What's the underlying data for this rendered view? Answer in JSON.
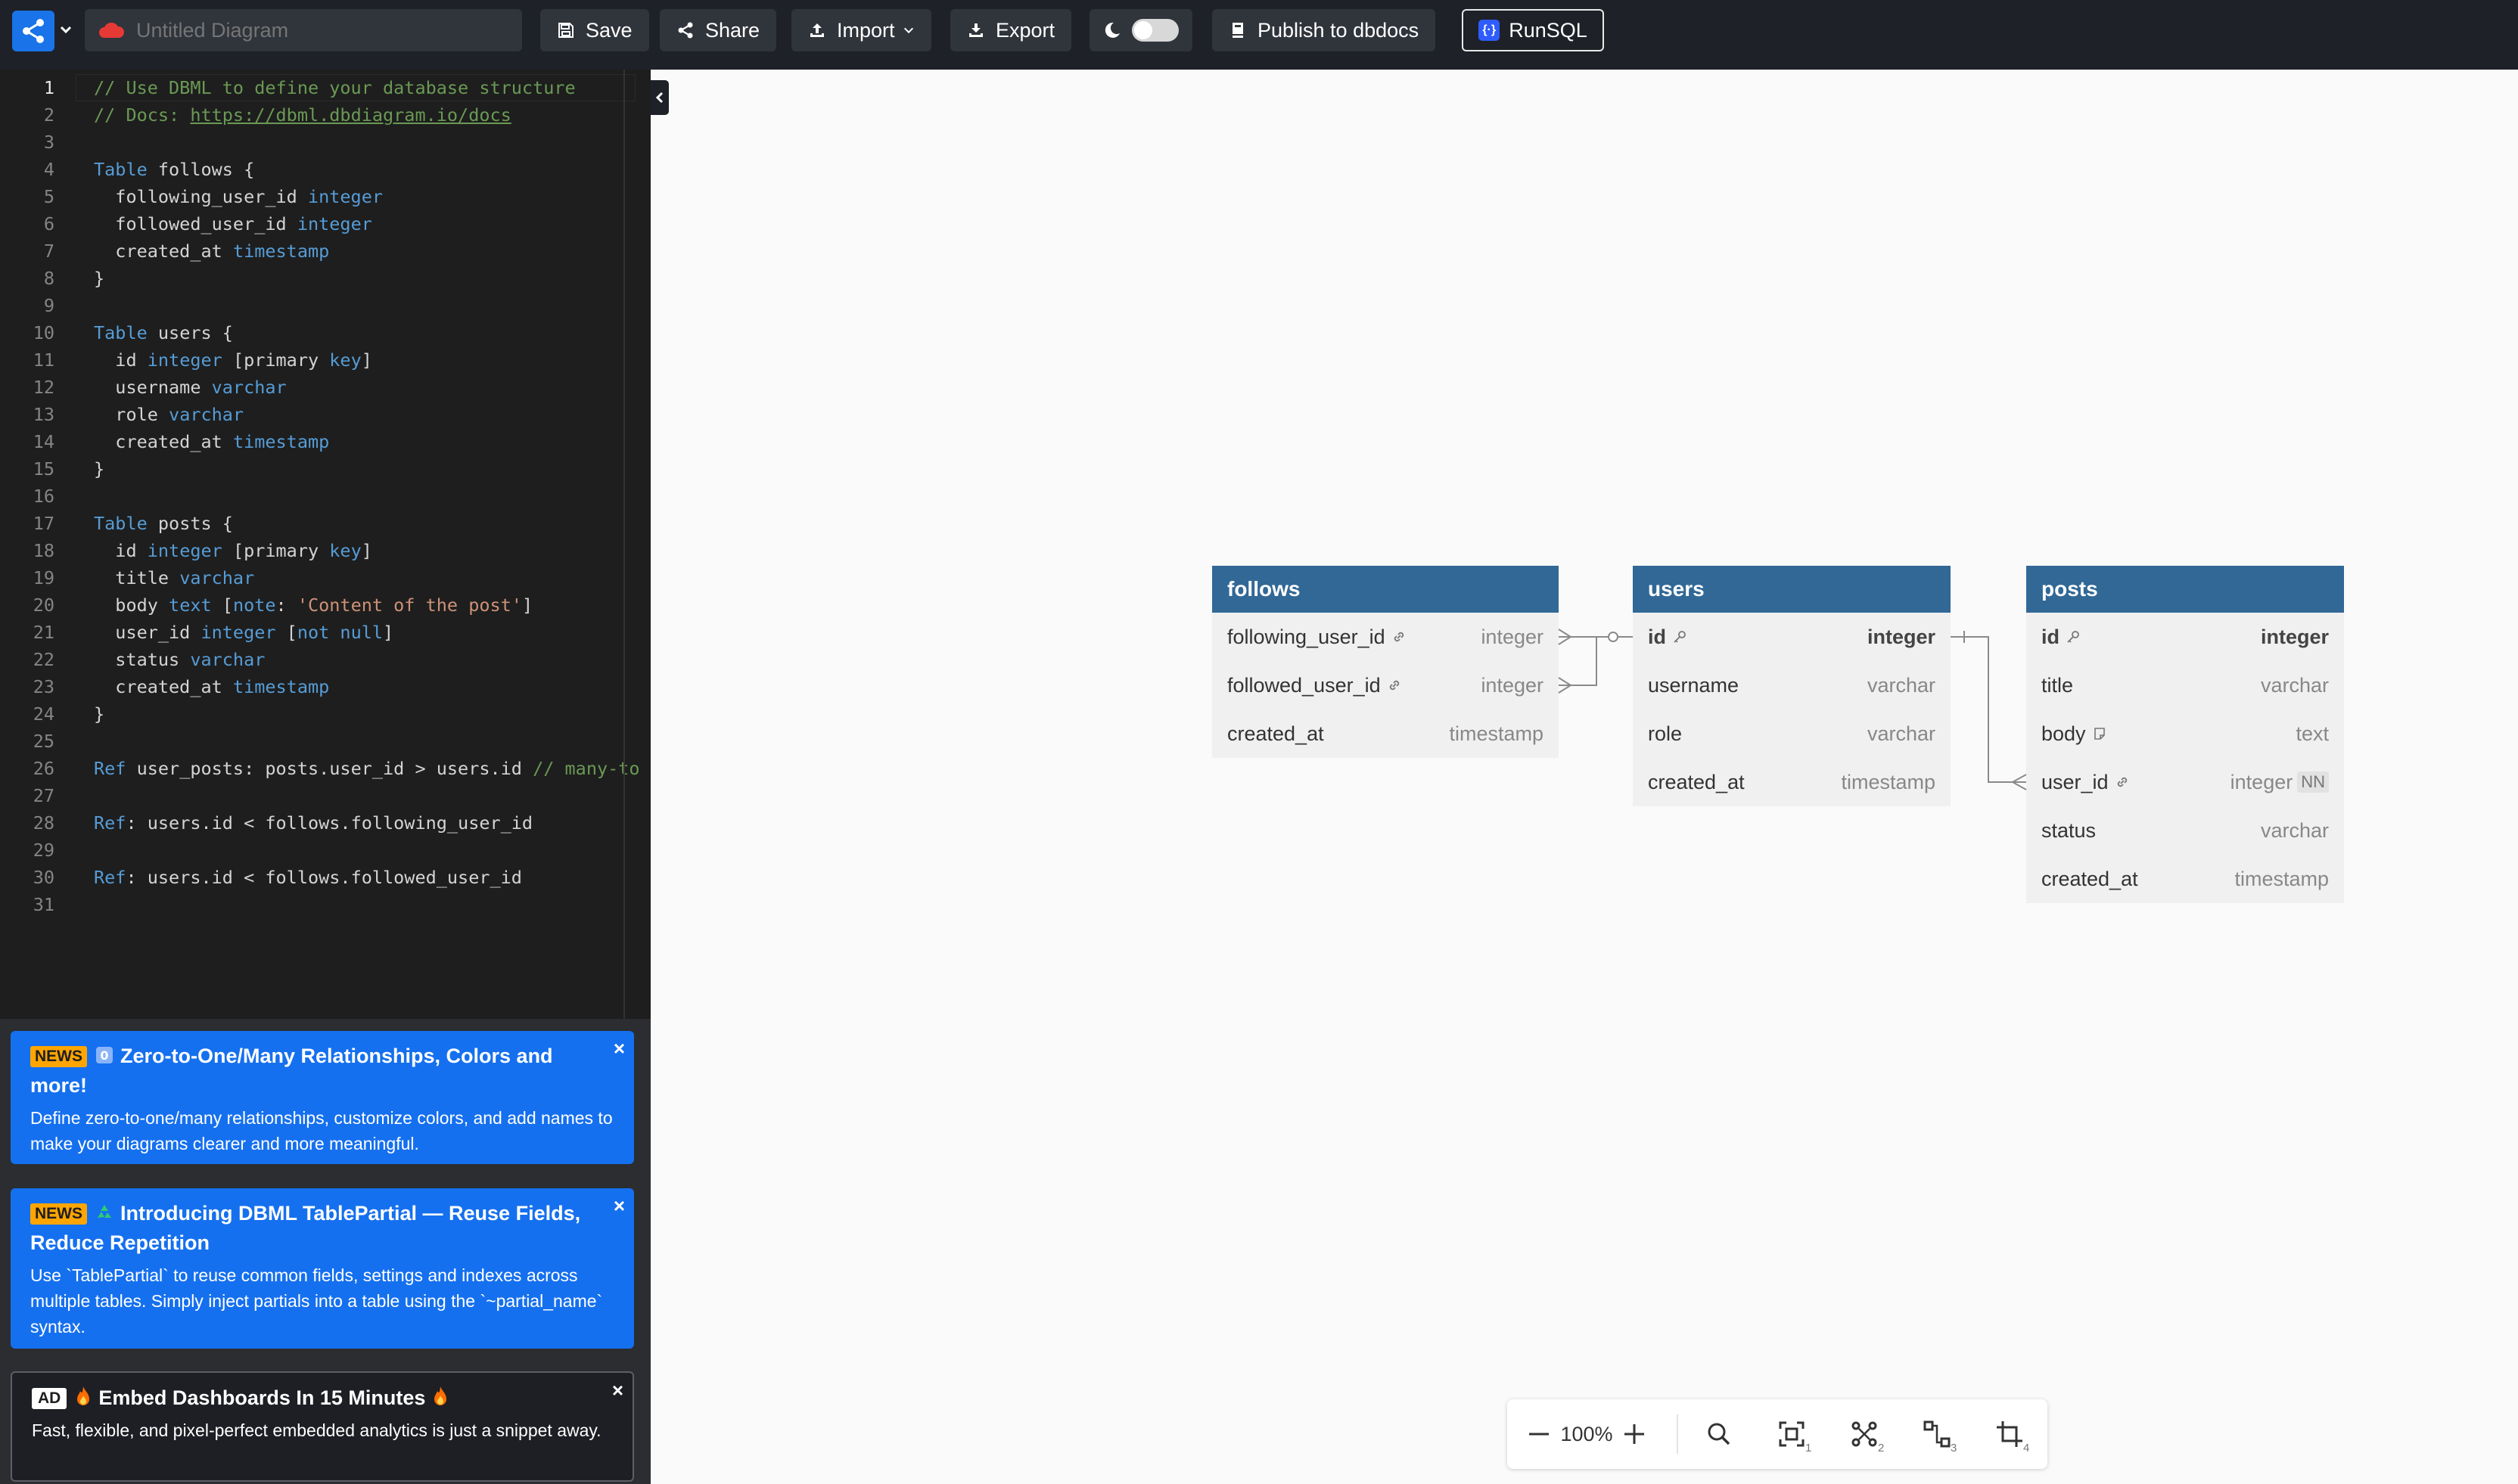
{
  "topbar": {
    "diagram_title_placeholder": "Untitled Diagram",
    "diagram_title_value": "",
    "save_label": "Save",
    "share_label": "Share",
    "import_label": "Import",
    "export_label": "Export",
    "publish_label": "Publish to dbdocs",
    "runsql_label": "RunSQL",
    "dark_mode_on": false,
    "colors": {
      "bar": "#1e2127",
      "logo": "#1a73e8",
      "button": "#30343b"
    }
  },
  "editor": {
    "active_line": 1,
    "lines": [
      {
        "n": "1",
        "tokens": [
          {
            "t": "// Use DBML to define your database structure",
            "c": "comment"
          }
        ]
      },
      {
        "n": "2",
        "tokens": [
          {
            "t": "// Docs: ",
            "c": "comment"
          },
          {
            "t": "https://dbml.dbdiagram.io/docs",
            "c": "link"
          }
        ]
      },
      {
        "n": "3",
        "tokens": []
      },
      {
        "n": "4",
        "tokens": [
          {
            "t": "Table",
            "c": "kw"
          },
          {
            "t": " follows {",
            "c": ""
          }
        ]
      },
      {
        "n": "5",
        "tokens": [
          {
            "t": "  following_user_id ",
            "c": ""
          },
          {
            "t": "integer",
            "c": "kw"
          }
        ]
      },
      {
        "n": "6",
        "tokens": [
          {
            "t": "  followed_user_id ",
            "c": ""
          },
          {
            "t": "integer",
            "c": "kw"
          }
        ]
      },
      {
        "n": "7",
        "tokens": [
          {
            "t": "  created_at ",
            "c": ""
          },
          {
            "t": "timestamp",
            "c": "kw"
          }
        ]
      },
      {
        "n": "8",
        "tokens": [
          {
            "t": "}",
            "c": ""
          }
        ]
      },
      {
        "n": "9",
        "tokens": []
      },
      {
        "n": "10",
        "tokens": [
          {
            "t": "Table",
            "c": "kw"
          },
          {
            "t": " users {",
            "c": ""
          }
        ]
      },
      {
        "n": "11",
        "tokens": [
          {
            "t": "  id ",
            "c": ""
          },
          {
            "t": "integer",
            "c": "kw"
          },
          {
            "t": " [primary ",
            "c": ""
          },
          {
            "t": "key",
            "c": "kw"
          },
          {
            "t": "]",
            "c": ""
          }
        ]
      },
      {
        "n": "12",
        "tokens": [
          {
            "t": "  username ",
            "c": ""
          },
          {
            "t": "varchar",
            "c": "kw"
          }
        ]
      },
      {
        "n": "13",
        "tokens": [
          {
            "t": "  role ",
            "c": ""
          },
          {
            "t": "varchar",
            "c": "kw"
          }
        ]
      },
      {
        "n": "14",
        "tokens": [
          {
            "t": "  created_at ",
            "c": ""
          },
          {
            "t": "timestamp",
            "c": "kw"
          }
        ]
      },
      {
        "n": "15",
        "tokens": [
          {
            "t": "}",
            "c": ""
          }
        ]
      },
      {
        "n": "16",
        "tokens": []
      },
      {
        "n": "17",
        "tokens": [
          {
            "t": "Table",
            "c": "kw"
          },
          {
            "t": " posts {",
            "c": ""
          }
        ]
      },
      {
        "n": "18",
        "tokens": [
          {
            "t": "  id ",
            "c": ""
          },
          {
            "t": "integer",
            "c": "kw"
          },
          {
            "t": " [primary ",
            "c": ""
          },
          {
            "t": "key",
            "c": "kw"
          },
          {
            "t": "]",
            "c": ""
          }
        ]
      },
      {
        "n": "19",
        "tokens": [
          {
            "t": "  title ",
            "c": ""
          },
          {
            "t": "varchar",
            "c": "kw"
          }
        ]
      },
      {
        "n": "20",
        "tokens": [
          {
            "t": "  body ",
            "c": ""
          },
          {
            "t": "text",
            "c": "kw"
          },
          {
            "t": " [",
            "c": ""
          },
          {
            "t": "note",
            "c": "kw"
          },
          {
            "t": ": ",
            "c": ""
          },
          {
            "t": "'Content of the post'",
            "c": "str"
          },
          {
            "t": "]",
            "c": ""
          }
        ]
      },
      {
        "n": "21",
        "tokens": [
          {
            "t": "  user_id ",
            "c": ""
          },
          {
            "t": "integer",
            "c": "kw"
          },
          {
            "t": " [",
            "c": ""
          },
          {
            "t": "not null",
            "c": "kw"
          },
          {
            "t": "]",
            "c": ""
          }
        ]
      },
      {
        "n": "22",
        "tokens": [
          {
            "t": "  status ",
            "c": ""
          },
          {
            "t": "varchar",
            "c": "kw"
          }
        ]
      },
      {
        "n": "23",
        "tokens": [
          {
            "t": "  created_at ",
            "c": ""
          },
          {
            "t": "timestamp",
            "c": "kw"
          }
        ]
      },
      {
        "n": "24",
        "tokens": [
          {
            "t": "}",
            "c": ""
          }
        ]
      },
      {
        "n": "25",
        "tokens": []
      },
      {
        "n": "26",
        "tokens": [
          {
            "t": "Ref",
            "c": "kw"
          },
          {
            "t": " user_posts: posts.user_id > users.id ",
            "c": ""
          },
          {
            "t": "// many-to",
            "c": "comment"
          }
        ]
      },
      {
        "n": "27",
        "tokens": []
      },
      {
        "n": "28",
        "tokens": [
          {
            "t": "Ref",
            "c": "kw"
          },
          {
            "t": ": users.id < follows.following_user_id",
            "c": ""
          }
        ]
      },
      {
        "n": "29",
        "tokens": []
      },
      {
        "n": "30",
        "tokens": [
          {
            "t": "Ref",
            "c": "kw"
          },
          {
            "t": ": users.id < follows.followed_user_id",
            "c": ""
          }
        ]
      },
      {
        "n": "31",
        "tokens": []
      }
    ]
  },
  "news": [
    {
      "badge": "NEWS",
      "title": "Zero-to-One/Many Relationships, Colors and more!",
      "body": "Define zero-to-one/many relationships, customize colors, and add names to make your diagrams clearer and more meaningful."
    },
    {
      "badge": "NEWS",
      "title": "Introducing DBML TablePartial — Reuse Fields, Reduce Repetition",
      "body": "Use `TablePartial` to reuse common fields, settings and indexes across multiple tables. Simply inject partials into a table using the `~partial_name` syntax."
    },
    {
      "badge": "AD",
      "title": "Embed Dashboards In 15 Minutes",
      "body": "Fast, flexible, and pixel-perfect embedded analytics is just a snippet away."
    }
  ],
  "tables": {
    "follows": {
      "name": "follows",
      "fields": [
        {
          "name": "following_user_id",
          "type": "integer"
        },
        {
          "name": "followed_user_id",
          "type": "integer"
        },
        {
          "name": "created_at",
          "type": "timestamp"
        }
      ]
    },
    "users": {
      "name": "users",
      "fields": [
        {
          "name": "id",
          "type": "integer"
        },
        {
          "name": "username",
          "type": "varchar"
        },
        {
          "name": "role",
          "type": "varchar"
        },
        {
          "name": "created_at",
          "type": "timestamp"
        }
      ]
    },
    "posts": {
      "name": "posts",
      "fields": [
        {
          "name": "id",
          "type": "integer"
        },
        {
          "name": "title",
          "type": "varchar"
        },
        {
          "name": "body",
          "type": "text"
        },
        {
          "name": "user_id",
          "type": "integer",
          "badge": "NN"
        },
        {
          "name": "status",
          "type": "varchar"
        },
        {
          "name": "created_at",
          "type": "timestamp"
        }
      ]
    },
    "header_color": "#316896"
  },
  "zoom": {
    "level": "100%",
    "shortcut_numbers": [
      "1",
      "2",
      "3",
      "4"
    ]
  }
}
